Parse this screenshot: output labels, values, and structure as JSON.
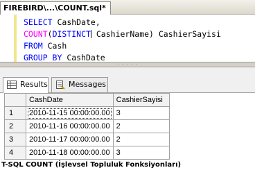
{
  "editor_tab": {
    "title": "FIREBIRD\\...\\COUNT.sql*"
  },
  "editor": {
    "lines": [
      [
        {
          "t": "SELECT",
          "c": "kw"
        },
        {
          "t": " CashDate,",
          "c": ""
        }
      ],
      [
        {
          "t": "COUNT",
          "c": "fn"
        },
        {
          "t": "(",
          "c": ""
        },
        {
          "t": "DISTINCT",
          "c": "kw"
        },
        {
          "t": "|",
          "c": "cursor"
        },
        {
          "t": " CashierName) CashierSayisi",
          "c": ""
        }
      ],
      [
        {
          "t": "FROM",
          "c": "kw"
        },
        {
          "t": " Cash",
          "c": ""
        }
      ],
      [
        {
          "t": "GROUP BY",
          "c": "kw"
        },
        {
          "t": " CashDate",
          "c": ""
        }
      ]
    ]
  },
  "results_tabs": [
    {
      "label": "Results",
      "icon": "results-grid-icon",
      "active": true
    },
    {
      "label": "Messages",
      "icon": "messages-icon",
      "active": false
    }
  ],
  "grid": {
    "columns": [
      "CashDate",
      "CashierSayisi"
    ],
    "rows": [
      [
        "1",
        "2010-11-15 00:00:00.00",
        "3"
      ],
      [
        "2",
        "2010-11-16 00:00:00.00",
        "2"
      ],
      [
        "3",
        "2010-11-17 00:00:00.00",
        "2"
      ],
      [
        "4",
        "2010-11-18 00:00:00.00",
        "3"
      ]
    ]
  },
  "footer": {
    "text": "T-SQL COUNT (İşlevsel Topluluk Fonksiyonları)"
  }
}
